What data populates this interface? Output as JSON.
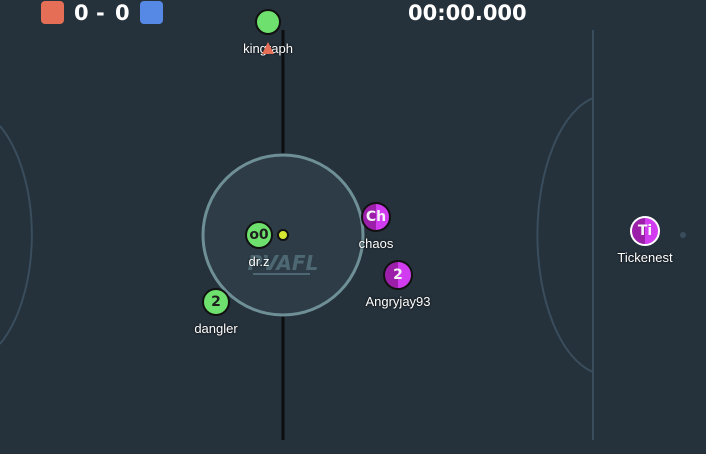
{
  "score": {
    "red": "0",
    "separator": "-",
    "blue": "0",
    "red_color": "#e56e56",
    "blue_color": "#5689e5"
  },
  "timer": "00:00.000",
  "logo_text": "PVAFL",
  "players": [
    {
      "name": "kingraph",
      "avatar": "",
      "team": "green"
    },
    {
      "name": "dr.z",
      "avatar": "o0",
      "team": "green"
    },
    {
      "name": "dangler",
      "avatar": "2",
      "team": "green"
    },
    {
      "name": "chaos",
      "avatar": "Ch",
      "team": "purple"
    },
    {
      "name": "Angryjay93",
      "avatar": "2",
      "team": "purple"
    },
    {
      "name": "Tickenest",
      "avatar": "Ti",
      "team": "purple"
    }
  ],
  "colors": {
    "pitch": "#25313b",
    "green_team": "#6ee06e",
    "purple_team": "#c22ee0",
    "ball": "#d6e832"
  }
}
